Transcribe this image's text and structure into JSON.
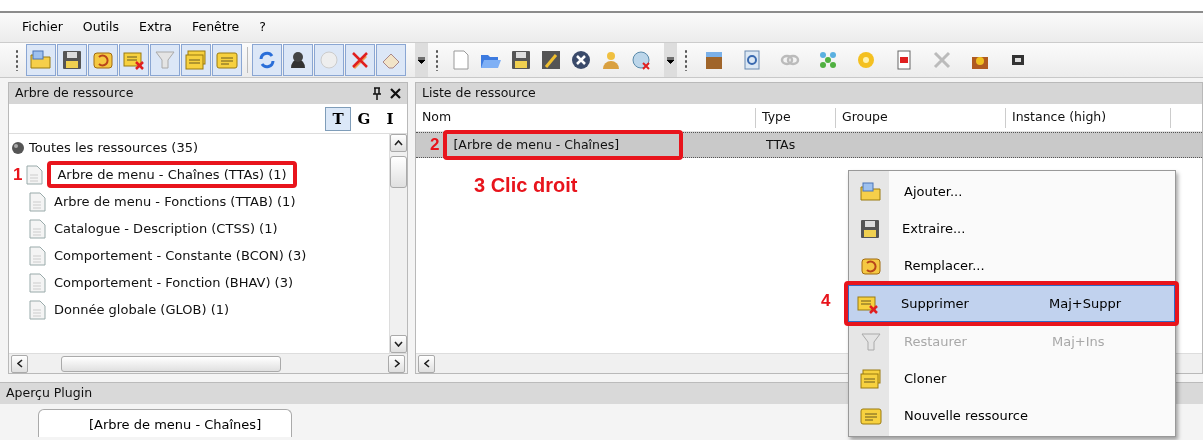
{
  "menu_bar": [
    {
      "label": "Fichier"
    },
    {
      "label": "Outils"
    },
    {
      "label": "Extra"
    },
    {
      "label": "Fenêtre"
    },
    {
      "label": "?"
    }
  ],
  "resource_tree_panel": {
    "title": "Arbre de ressource",
    "view_buttons": [
      {
        "label": "T",
        "selected": true
      },
      {
        "label": "G",
        "selected": false
      },
      {
        "label": "I",
        "selected": false
      }
    ],
    "tree": [
      {
        "label": "Toutes les ressources (35)",
        "children": [
          {
            "label": "Arbre de menu - Chaînes (TTAs) (1)",
            "annotation": "1"
          },
          {
            "label": "Arbre de menu - Fonctions (TTAB) (1)"
          },
          {
            "label": "Catalogue - Description (CTSS) (1)"
          },
          {
            "label": "Comportement - Constante (BCON) (3)"
          },
          {
            "label": "Comportement - Fonction (BHAV) (3)"
          },
          {
            "label": "Donnée globale (GLOB) (1)"
          }
        ]
      }
    ]
  },
  "resource_list_panel": {
    "title": "Liste de ressource",
    "columns": [
      "Nom",
      "Type",
      "Groupe",
      "Instance (high)"
    ],
    "rows": [
      {
        "cells": [
          "[Arbre de menu - Chaînes]",
          "TTAs"
        ],
        "selected": true,
        "annotation": "2"
      }
    ],
    "callout": "3 Clic droit"
  },
  "context_menu": [
    {
      "label": "Ajouter...",
      "selected": false,
      "disabled": false
    },
    {
      "label": "Extraire...",
      "selected": false,
      "disabled": false
    },
    {
      "label": "Remplacer...",
      "selected": false,
      "disabled": false
    },
    {
      "label": "Supprimer",
      "shortcut": "Maj+Suppr",
      "selected": true,
      "disabled": false,
      "annotation": "4"
    },
    {
      "label": "Restaurer",
      "shortcut": "Maj+Ins",
      "selected": false,
      "disabled": true
    },
    {
      "label": "Cloner",
      "selected": false,
      "disabled": false
    },
    {
      "label": "Nouvelle ressource",
      "selected": false,
      "disabled": false
    }
  ],
  "plugin_panel": {
    "title": "Aperçu Plugin",
    "tabs": [
      {
        "label": "[Arbre de menu - Chaînes]",
        "selected": true
      }
    ]
  }
}
